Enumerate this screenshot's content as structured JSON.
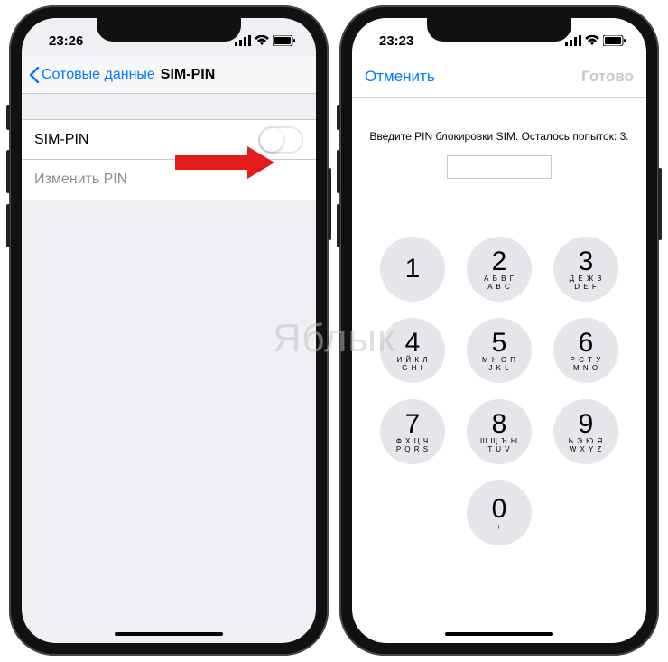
{
  "watermark": "Яблык",
  "left": {
    "time": "23:26",
    "back_label": "Сотовые данные",
    "title": "SIM-PIN",
    "rows": {
      "sim_pin": "SIM-PIN",
      "change_pin": "Изменить PIN"
    }
  },
  "right": {
    "time": "23:23",
    "cancel": "Отменить",
    "done": "Готово",
    "prompt": "Введите PIN блокировки SIM. Осталось попыток: 3.",
    "keys": {
      "k1": {
        "d": "1",
        "l": ""
      },
      "k2": {
        "d": "2",
        "l": "А Б В Г\nA B C"
      },
      "k3": {
        "d": "3",
        "l": "Д Е Ж З\nD E F"
      },
      "k4": {
        "d": "4",
        "l": "И Й К Л\nG H I"
      },
      "k5": {
        "d": "5",
        "l": "М Н О П\nJ K L"
      },
      "k6": {
        "d": "6",
        "l": "Р С Т У\nM N O"
      },
      "k7": {
        "d": "7",
        "l": "Ф Х Ц Ч\nP Q R S"
      },
      "k8": {
        "d": "8",
        "l": "Ш Щ Ъ Ы\nT U V"
      },
      "k9": {
        "d": "9",
        "l": "Ь Э Ю Я\nW X Y Z"
      },
      "k0": {
        "d": "0",
        "l": "+"
      }
    }
  }
}
